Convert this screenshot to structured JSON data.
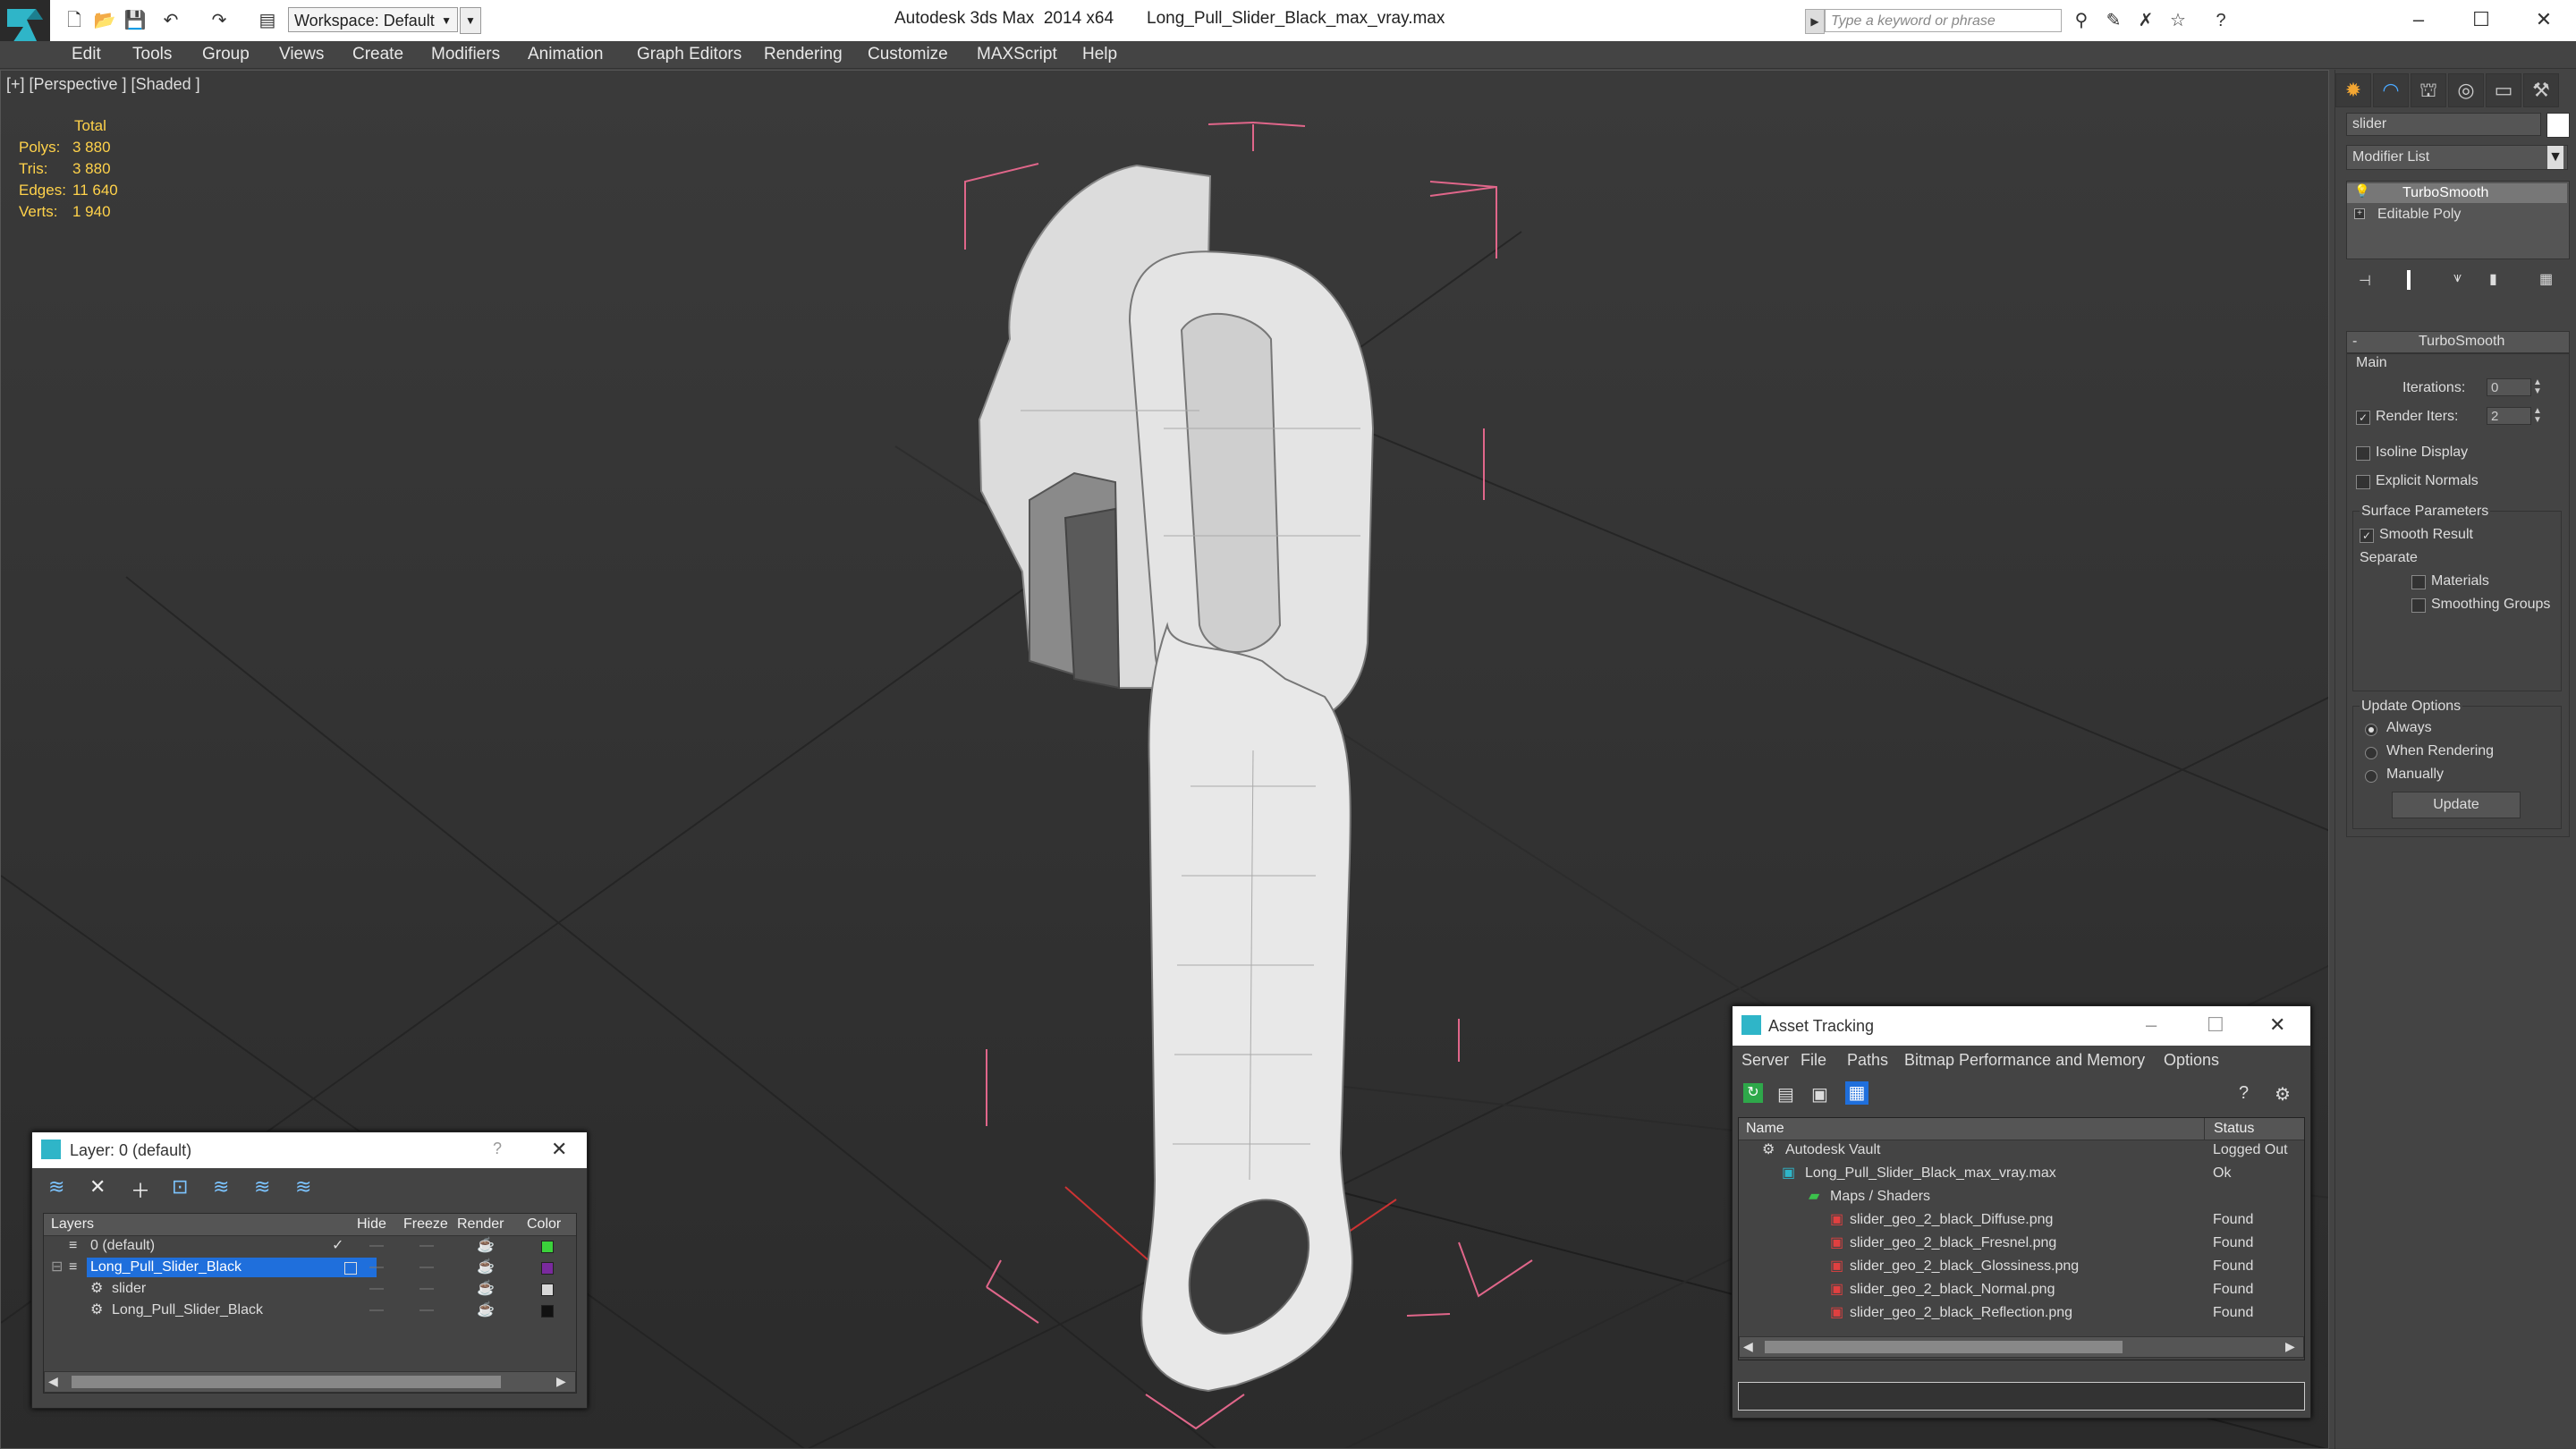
{
  "titlebar": {
    "app_title": "Autodesk 3ds Max  2014 x64",
    "file_title": "Long_Pull_Slider_Black_max_vray.max",
    "workspace": "Workspace: Default",
    "search_placeholder": "Type a keyword or phrase"
  },
  "menu": [
    "Edit",
    "Tools",
    "Group",
    "Views",
    "Create",
    "Modifiers",
    "Animation",
    "Graph Editors",
    "Rendering",
    "Customize",
    "MAXScript",
    "Help"
  ],
  "viewport": {
    "label": "[+] [Perspective ] [Shaded ]",
    "stats": {
      "header": "Total",
      "polys_label": "Polys:",
      "polys": "3 880",
      "tris_label": "Tris:",
      "tris": "3 880",
      "edges_label": "Edges:",
      "edges": "11 640",
      "verts_label": "Verts:",
      "verts": "1 940"
    }
  },
  "command_panel": {
    "object_name": "slider",
    "modifier_list": "Modifier List",
    "stack": [
      "TurboSmooth",
      "Editable Poly"
    ],
    "rollout_title": "TurboSmooth",
    "main_label": "Main",
    "iterations_label": "Iterations:",
    "iterations": "0",
    "render_iters_label": "Render Iters:",
    "render_iters": "2",
    "isoline_label": "Isoline Display",
    "explicit_normals_label": "Explicit Normals",
    "surface_params_label": "Surface Parameters",
    "smooth_result_label": "Smooth Result",
    "separate_label": "Separate",
    "materials_label": "Materials",
    "smoothing_groups_label": "Smoothing Groups",
    "update_options_label": "Update Options",
    "always_label": "Always",
    "when_rendering_label": "When Rendering",
    "manually_label": "Manually",
    "update_button": "Update"
  },
  "layer_dialog": {
    "title": "Layer: 0 (default)",
    "columns": [
      "Layers",
      "Hide",
      "Freeze",
      "Render",
      "Color"
    ],
    "rows": [
      {
        "name": "0 (default)",
        "color": "#3bd13b"
      },
      {
        "name": "Long_Pull_Slider_Black",
        "color": "#7a2a9e"
      },
      {
        "name": "slider",
        "color": "#d8d8d8"
      },
      {
        "name": "Long_Pull_Slider_Black",
        "color": "#111111"
      }
    ]
  },
  "asset_dialog": {
    "title": "Asset Tracking",
    "menu": [
      "Server",
      "File",
      "Paths",
      "Bitmap Performance and Memory",
      "Options"
    ],
    "columns": [
      "Name",
      "Status"
    ],
    "rows": [
      {
        "name": "Autodesk Vault",
        "status": "Logged Out"
      },
      {
        "name": "Long_Pull_Slider_Black_max_vray.max",
        "status": "Ok"
      },
      {
        "name": "Maps / Shaders",
        "status": ""
      },
      {
        "name": "slider_geo_2_black_Diffuse.png",
        "status": "Found"
      },
      {
        "name": "slider_geo_2_black_Fresnel.png",
        "status": "Found"
      },
      {
        "name": "slider_geo_2_black_Glossiness.png",
        "status": "Found"
      },
      {
        "name": "slider_geo_2_black_Normal.png",
        "status": "Found"
      },
      {
        "name": "slider_geo_2_black_Reflection.png",
        "status": "Found"
      }
    ]
  }
}
